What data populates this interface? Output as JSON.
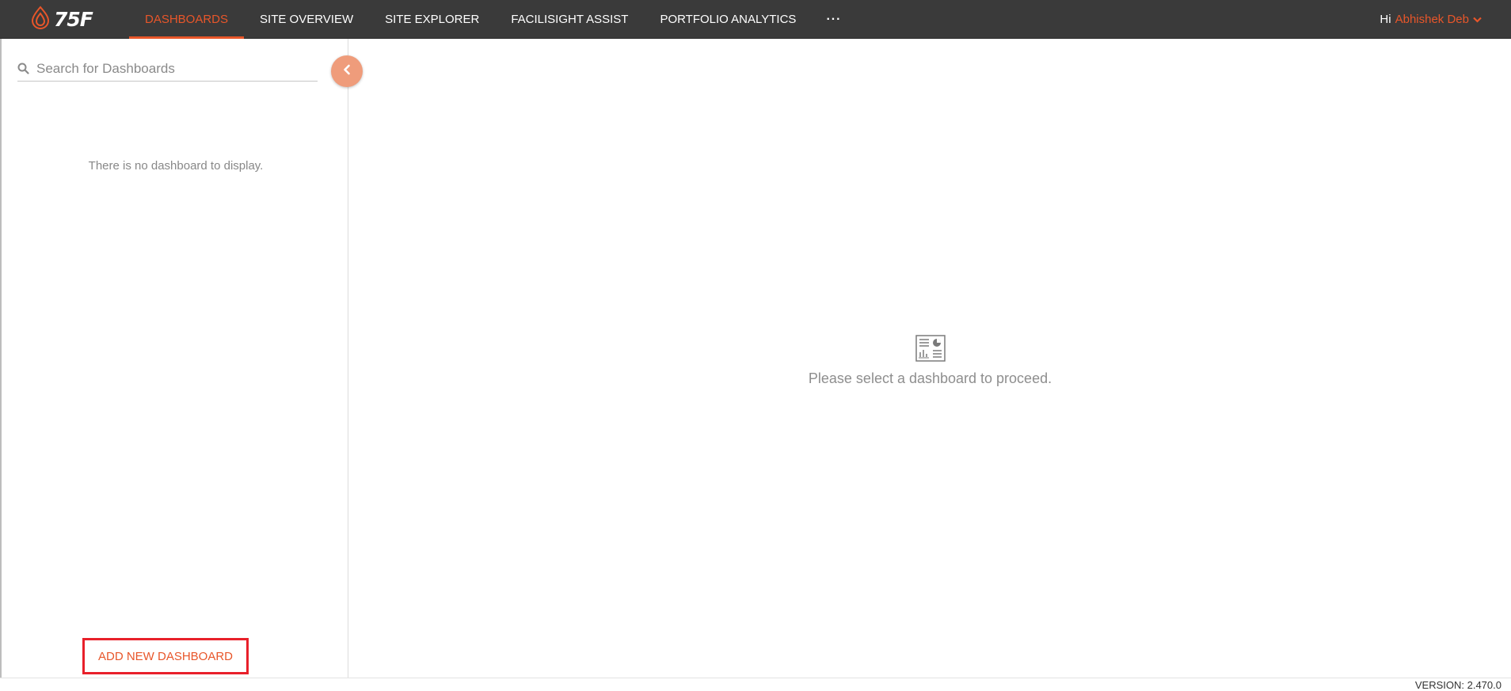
{
  "header": {
    "logo_text": "75F",
    "nav": [
      {
        "label": "DASHBOARDS",
        "active": true
      },
      {
        "label": "SITE OVERVIEW",
        "active": false
      },
      {
        "label": "SITE EXPLORER",
        "active": false
      },
      {
        "label": "FACILISIGHT ASSIST",
        "active": false
      },
      {
        "label": "PORTFOLIO ANALYTICS",
        "active": false
      }
    ],
    "more_label": "···",
    "user": {
      "greeting": "Hi",
      "name": "Abhishek Deb"
    }
  },
  "sidebar": {
    "search_placeholder": "Search for Dashboards",
    "empty_message": "There is no dashboard to display.",
    "add_button_label": "ADD NEW DASHBOARD"
  },
  "main": {
    "placeholder_text": "Please select a dashboard to proceed."
  },
  "footer": {
    "version": "VERSION: 2.470.0"
  },
  "theme": {
    "accent": "#e8562a",
    "topbar_bg": "#3a3a3a",
    "highlight_border": "#e8202a"
  },
  "icons": {
    "logo": "75f-flame-logo",
    "search": "search-icon",
    "collapse": "chevron-left-icon",
    "user_menu": "chevron-down-icon",
    "placeholder": "dashboard-icon"
  }
}
